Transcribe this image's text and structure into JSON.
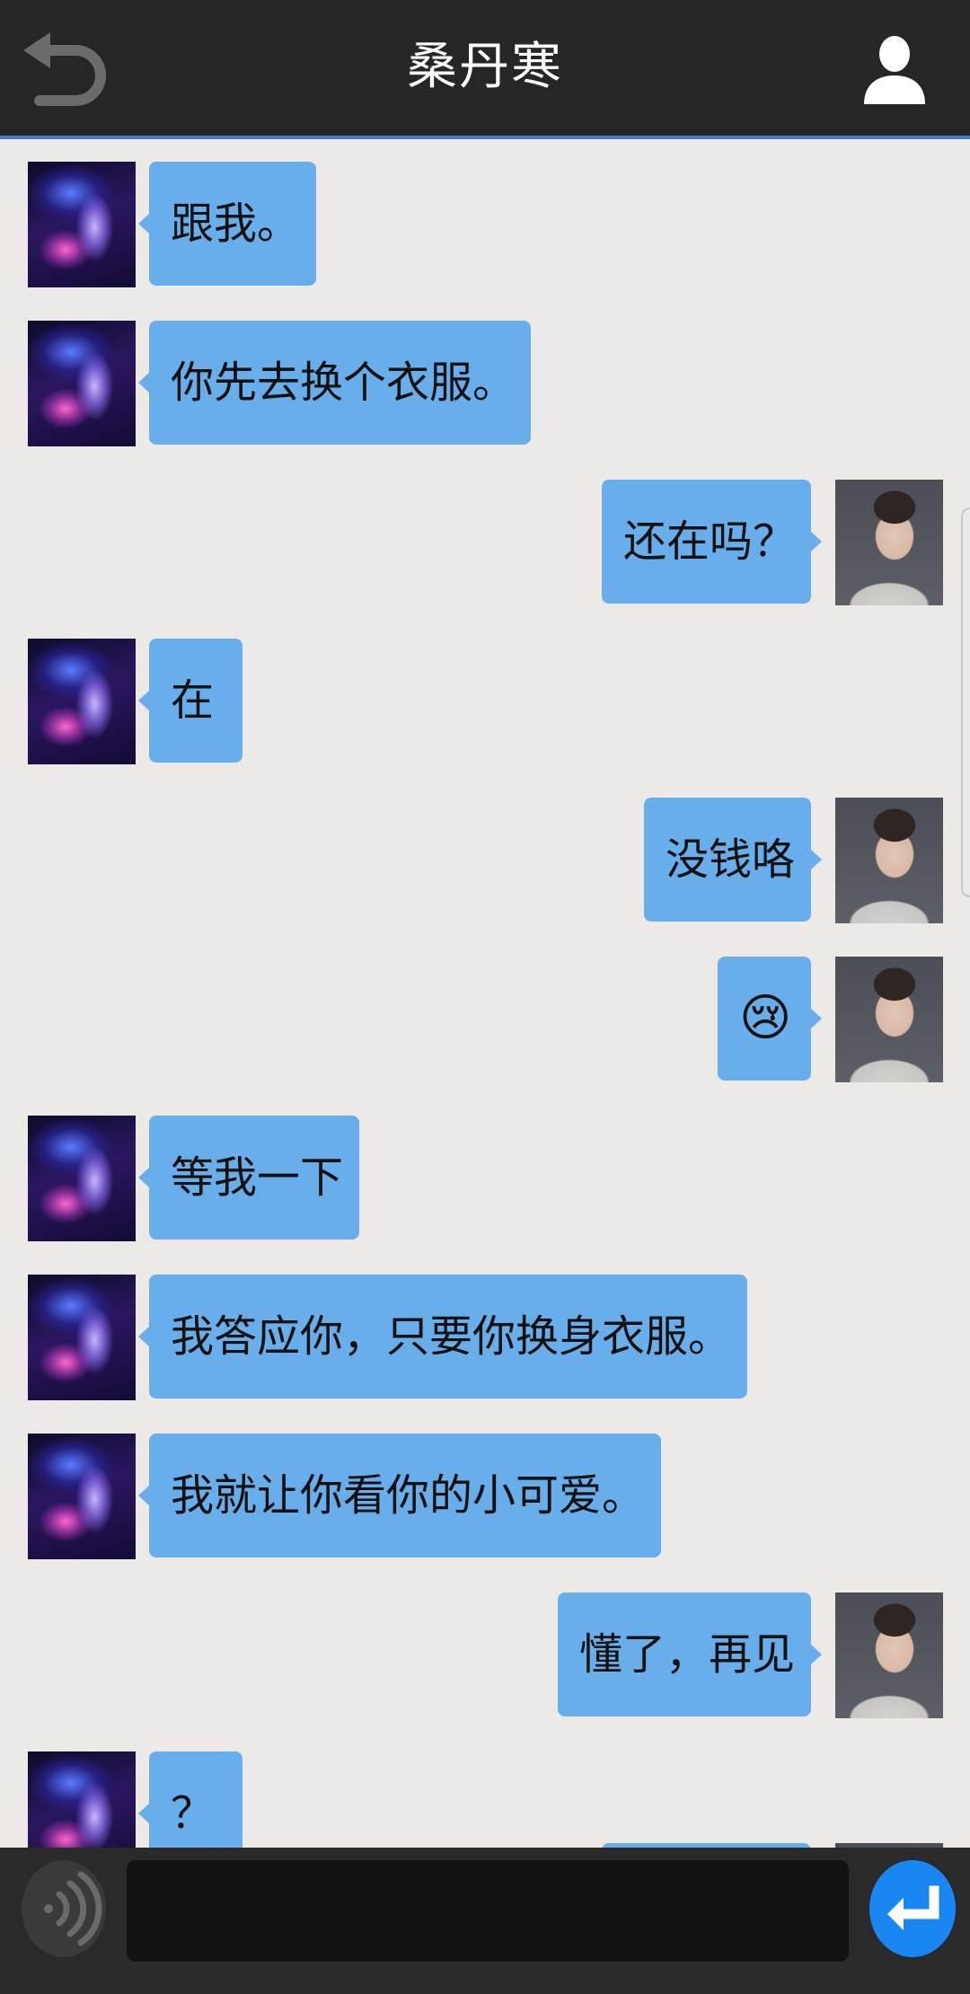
{
  "header": {
    "title": "桑丹寒",
    "back_icon": "back-arrow-icon",
    "profile_icon": "user-profile-icon"
  },
  "messages": [
    {
      "side": "left",
      "text": "跟我。"
    },
    {
      "side": "left",
      "text": "你先去换个衣服。"
    },
    {
      "side": "right",
      "text": "还在吗？"
    },
    {
      "side": "left",
      "text": "在"
    },
    {
      "side": "right",
      "text": "没钱咯"
    },
    {
      "side": "right",
      "text": "😢"
    },
    {
      "side": "left",
      "text": "等我一下"
    },
    {
      "side": "left",
      "text": "我答应你，只要你换身衣服。"
    },
    {
      "side": "left",
      "text": "我就让你看你的小可爱。"
    },
    {
      "side": "right",
      "text": "懂了，再见"
    },
    {
      "side": "left",
      "text": "？"
    }
  ],
  "input_bar": {
    "voice_icon": "voice-wave-icon",
    "input_value": "",
    "send_icon": "send-return-icon"
  },
  "colors": {
    "header_bg": "#262626",
    "chat_bg": "#ece9e7",
    "bubble": "#67aeea",
    "send_button": "#1a86f2"
  }
}
